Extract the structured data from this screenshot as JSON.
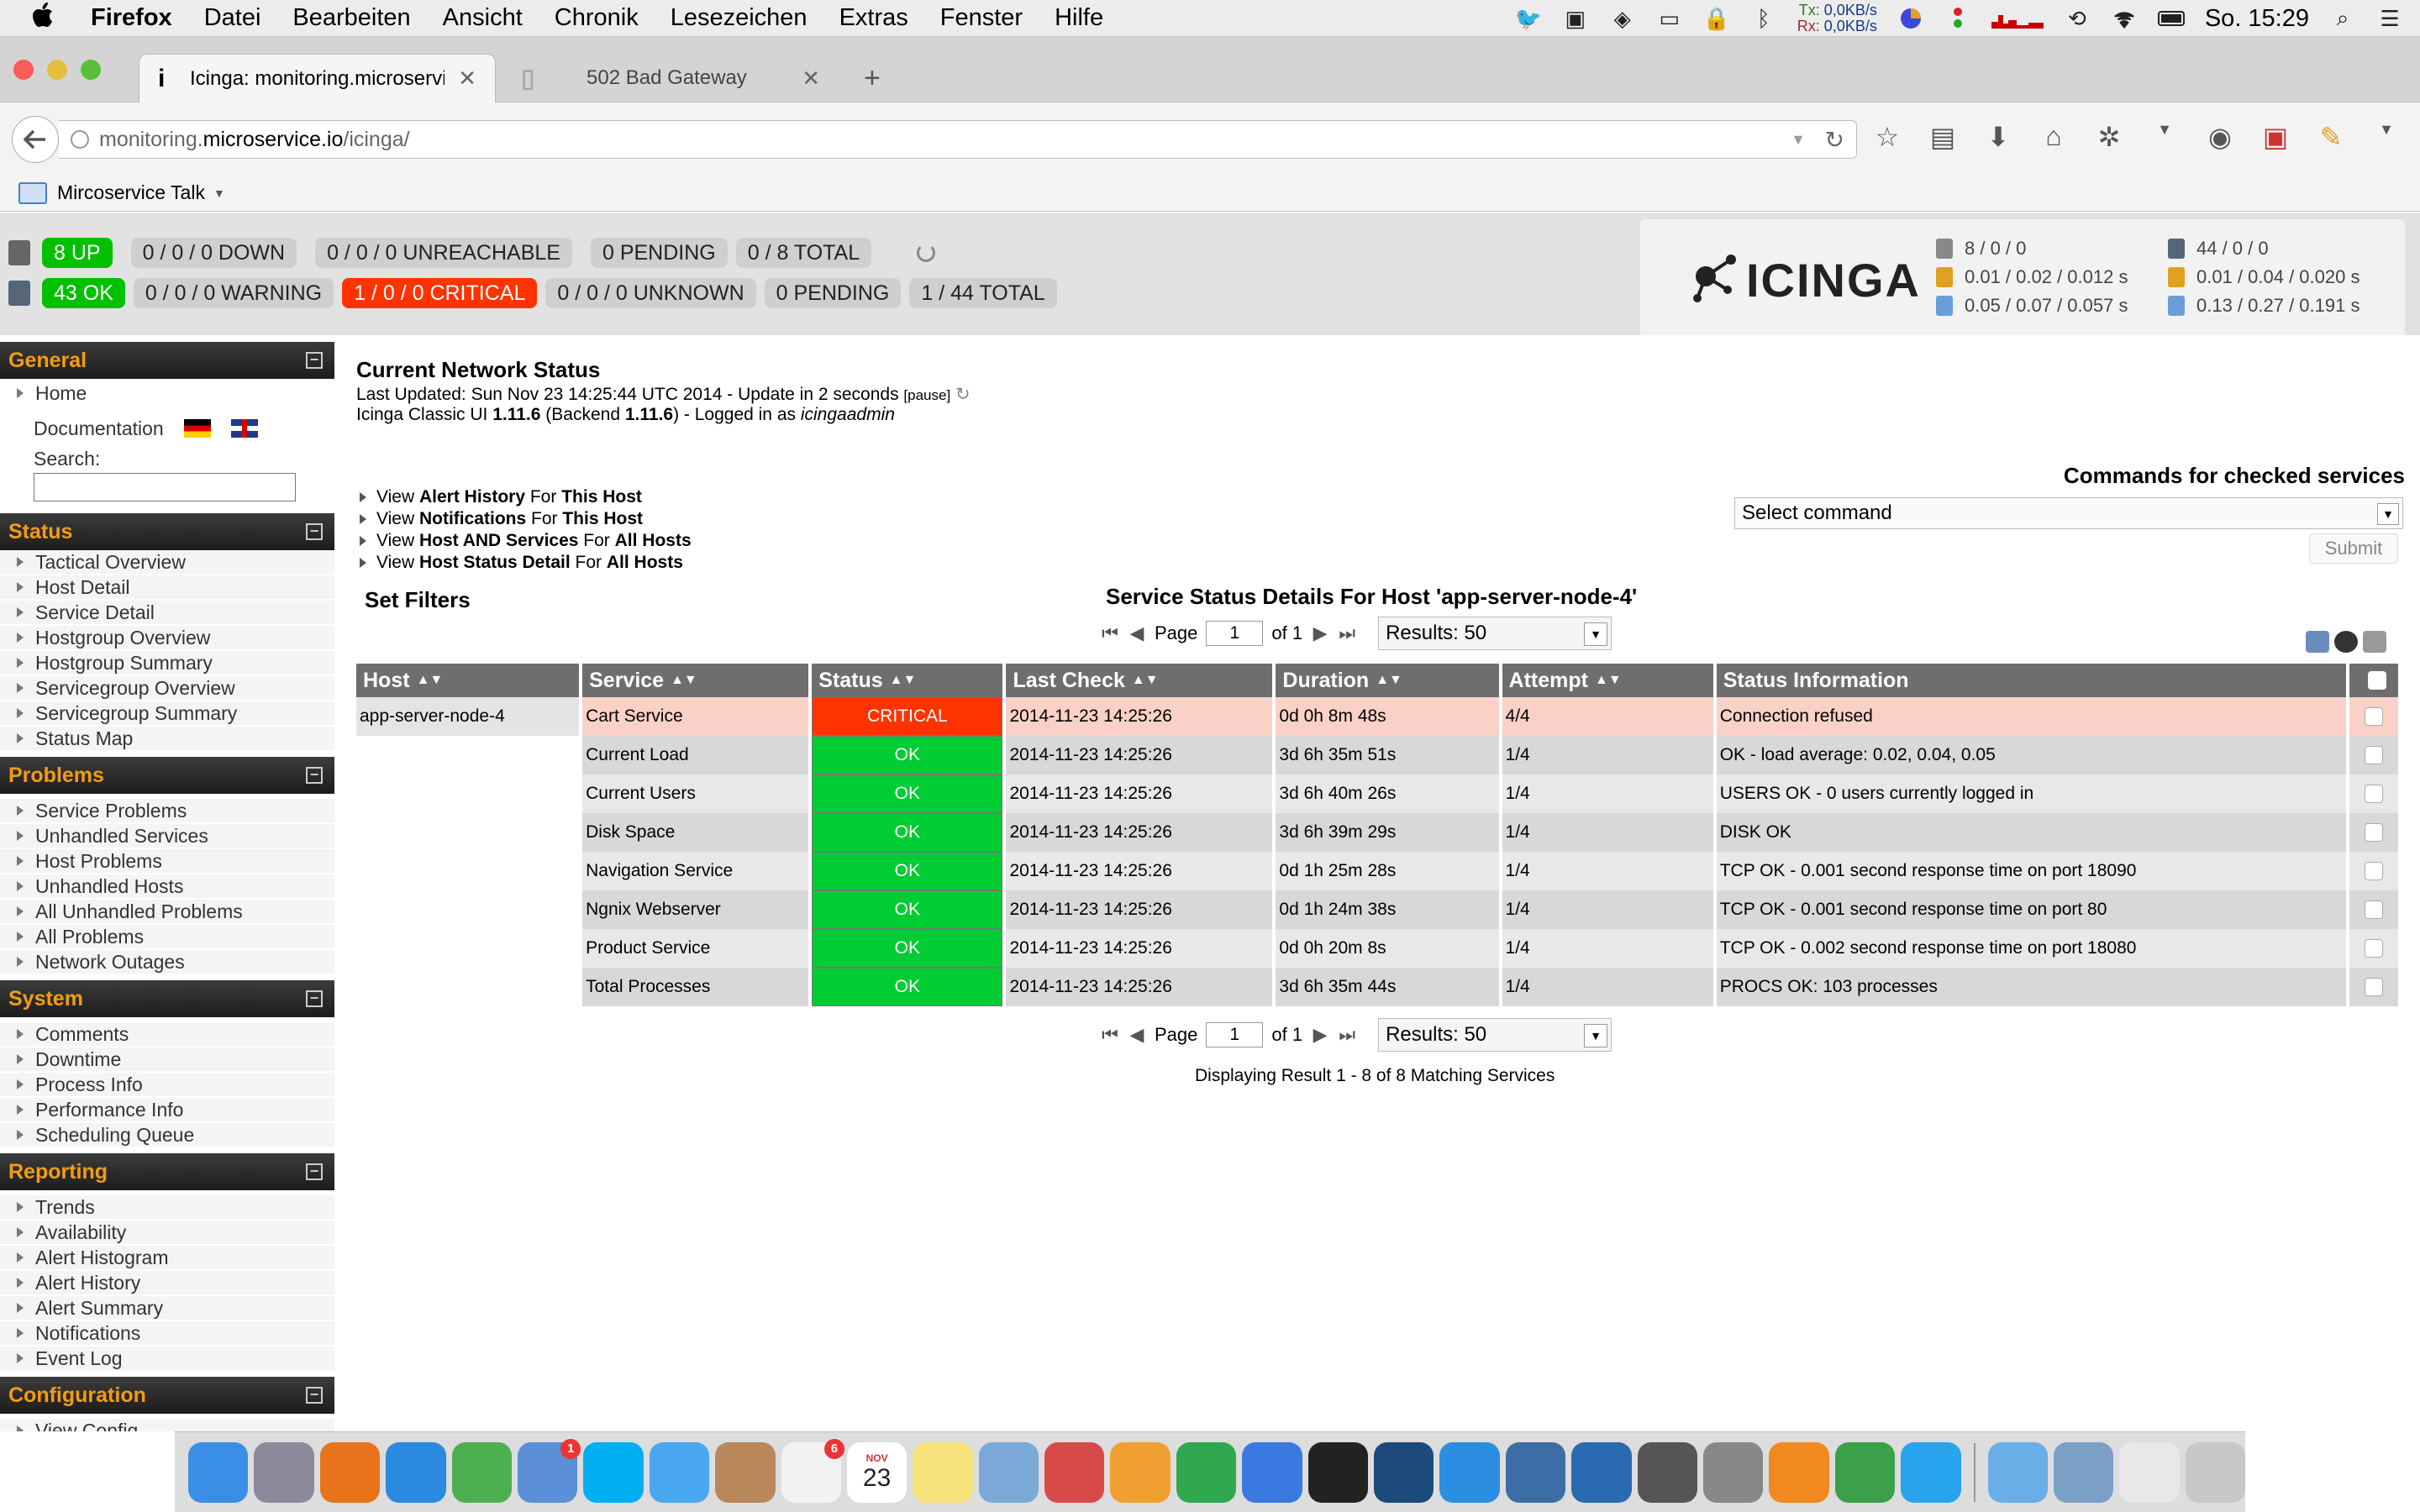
{
  "menubar": {
    "app_name": "Firefox",
    "items": [
      "Datei",
      "Bearbeiten",
      "Ansicht",
      "Chronik",
      "Lesezeichen",
      "Extras",
      "Fenster",
      "Hilfe"
    ],
    "net_tx": "Tx:",
    "net_tx_val": "0,0KB/s",
    "net_rx": "Rx:",
    "net_rx_val": "0,0KB/s",
    "clock": "So. 15:29"
  },
  "browser": {
    "tabs": [
      {
        "icon": "i",
        "title": "Icinga: monitoring.microservi..."
      },
      {
        "icon": "",
        "title": "502 Bad Gateway"
      }
    ],
    "url_prefix": "monitoring.",
    "url_domain": "microservice.io",
    "url_path": "/icinga/",
    "bookmark": "Mircoservice Talk"
  },
  "status_bar": {
    "hosts": {
      "up": "8 UP",
      "down": "0 / 0 / 0 DOWN",
      "unreachable": "0 / 0 / 0 UNREACHABLE",
      "pending": "0 PENDING",
      "total": "0 / 8 TOTAL"
    },
    "services": {
      "ok": "43 OK",
      "warning": "0 / 0 / 0 WARNING",
      "critical": "1 / 0 / 0 CRITICAL",
      "unknown": "0 / 0 / 0 UNKNOWN",
      "pending": "0 PENDING",
      "total": "1 / 44 TOTAL"
    }
  },
  "logo": {
    "word": "ICINGA"
  },
  "perf": {
    "hosts": [
      "8 / 0 / 0",
      "0.01 / 0.02 / 0.012 s",
      "0.05 / 0.07 / 0.057 s"
    ],
    "services": [
      "44 / 0 / 0",
      "0.01 / 0.04 / 0.020 s",
      "0.13 / 0.27 / 0.191 s"
    ]
  },
  "sidebar": {
    "general": {
      "title": "General",
      "home": "Home",
      "documentation": "Documentation",
      "search_label": "Search:"
    },
    "status": {
      "title": "Status",
      "items": [
        "Tactical Overview",
        "Host Detail",
        "Service Detail",
        "Hostgroup Overview",
        "Hostgroup Summary",
        "Servicegroup Overview",
        "Servicegroup Summary",
        "Status Map"
      ]
    },
    "problems": {
      "title": "Problems",
      "items": [
        "Service Problems",
        "Unhandled Services",
        "Host Problems",
        "Unhandled Hosts",
        "All Unhandled Problems",
        "All Problems",
        "Network Outages"
      ]
    },
    "system": {
      "title": "System",
      "items": [
        "Comments",
        "Downtime",
        "Process Info",
        "Performance Info",
        "Scheduling Queue"
      ]
    },
    "reporting": {
      "title": "Reporting",
      "items": [
        "Trends",
        "Availability",
        "Alert Histogram",
        "Alert History",
        "Alert Summary",
        "Notifications",
        "Event Log"
      ]
    },
    "configuration": {
      "title": "Configuration",
      "items": [
        "View Config"
      ]
    }
  },
  "main": {
    "title": "Current Network Status",
    "last_updated": "Last Updated: Sun Nov 23 14:25:44 UTC 2014 - Update in 2 seconds",
    "pause": "[pause]",
    "version_pre": "Icinga Classic UI ",
    "version": "1.11.6",
    "backend_pre": " (Backend ",
    "backend": "1.11.6",
    "logged_in": ") - Logged in as ",
    "user": "icingaadmin",
    "view_links": [
      {
        "pre": "View ",
        "bold": "Alert History",
        "mid": " For ",
        "bold2": "This Host"
      },
      {
        "pre": "View ",
        "bold": "Notifications",
        "mid": " For ",
        "bold2": "This Host"
      },
      {
        "pre": "View ",
        "bold": "Host AND Services",
        "mid": " For ",
        "bold2": "All Hosts"
      },
      {
        "pre": "View ",
        "bold": "Host Status Detail",
        "mid": " For ",
        "bold2": "All Hosts"
      }
    ],
    "set_filters": "Set Filters",
    "commands_title": "Commands for checked services",
    "command_select": "Select command",
    "submit": "Submit",
    "table_title": "Service Status Details For Host 'app-server-node-4'",
    "pager": {
      "page_label": "Page",
      "page_value": "1",
      "of_label": "of 1",
      "results": "Results: 50"
    },
    "columns": [
      "Host",
      "Service",
      "Status",
      "Last Check",
      "Duration",
      "Attempt",
      "Status Information"
    ],
    "rows": [
      {
        "host": "app-server-node-4",
        "service": "Cart Service",
        "status": "CRITICAL",
        "last_check": "2014-11-23 14:25:26",
        "duration": "0d 0h 8m 48s",
        "attempt": "4/4",
        "info": "Connection refused"
      },
      {
        "host": "",
        "service": "Current Load",
        "status": "OK",
        "last_check": "2014-11-23 14:25:26",
        "duration": "3d 6h 35m 51s",
        "attempt": "1/4",
        "info": "OK - load average: 0.02, 0.04, 0.05"
      },
      {
        "host": "",
        "service": "Current Users",
        "status": "OK",
        "last_check": "2014-11-23 14:25:26",
        "duration": "3d 6h 40m 26s",
        "attempt": "1/4",
        "info": "USERS OK - 0 users currently logged in"
      },
      {
        "host": "",
        "service": "Disk Space",
        "status": "OK",
        "last_check": "2014-11-23 14:25:26",
        "duration": "3d 6h 39m 29s",
        "attempt": "1/4",
        "info": "DISK OK"
      },
      {
        "host": "",
        "service": "Navigation Service",
        "status": "OK",
        "last_check": "2014-11-23 14:25:26",
        "duration": "0d 1h 25m 28s",
        "attempt": "1/4",
        "info": "TCP OK - 0.001 second response time on port 18090"
      },
      {
        "host": "",
        "service": "Ngnix Webserver",
        "status": "OK",
        "last_check": "2014-11-23 14:25:26",
        "duration": "0d 1h 24m 38s",
        "attempt": "1/4",
        "info": "TCP OK - 0.001 second response time on port 80"
      },
      {
        "host": "",
        "service": "Product Service",
        "status": "OK",
        "last_check": "2014-11-23 14:25:26",
        "duration": "0d 0h 20m 8s",
        "attempt": "1/4",
        "info": "TCP OK - 0.002 second response time on port 18080"
      },
      {
        "host": "",
        "service": "Total Processes",
        "status": "OK",
        "last_check": "2014-11-23 14:25:26",
        "duration": "3d 6h 35m 44s",
        "attempt": "1/4",
        "info": "PROCS OK: 103 processes"
      }
    ],
    "display_result": "Displaying Result 1 - 8 of 8 Matching Services"
  },
  "dock": {
    "mail_badge": "1",
    "reminders_badge": "6",
    "calendar_month": "NOV",
    "calendar_day": "23",
    "apps": [
      {
        "name": "finder",
        "color": "#3a8ee6"
      },
      {
        "name": "launchpad",
        "color": "#8a8a9a"
      },
      {
        "name": "firefox",
        "color": "#e8731a"
      },
      {
        "name": "safari",
        "color": "#2a8ae0"
      },
      {
        "name": "chrome",
        "color": "#4caf50"
      },
      {
        "name": "mail",
        "color": "#5b8fd8"
      },
      {
        "name": "skype",
        "color": "#00aff0"
      },
      {
        "name": "messages",
        "color": "#4aa8f0"
      },
      {
        "name": "contacts",
        "color": "#b8875a"
      },
      {
        "name": "reminders",
        "color": "#f2f2f2"
      },
      {
        "name": "calendar",
        "color": "#ffffff"
      },
      {
        "name": "notes",
        "color": "#f6e27a"
      },
      {
        "name": "preview",
        "color": "#7aa9d8"
      },
      {
        "name": "photos",
        "color": "#d84a4a"
      },
      {
        "name": "pages",
        "color": "#f0a030"
      },
      {
        "name": "numbers",
        "color": "#2fa84f"
      },
      {
        "name": "keynote",
        "color": "#3a7ae0"
      },
      {
        "name": "terminal",
        "color": "#222222"
      },
      {
        "name": "sourcetree",
        "color": "#1c4a7a"
      },
      {
        "name": "intellij",
        "color": "#2c8ee0"
      },
      {
        "name": "postgres",
        "color": "#3c6ea5"
      },
      {
        "name": "elephant",
        "color": "#2a6ab0"
      },
      {
        "name": "sublime",
        "color": "#555555"
      },
      {
        "name": "system-preferences",
        "color": "#888888"
      },
      {
        "name": "ibooks",
        "color": "#f08a20"
      },
      {
        "name": "gitx",
        "color": "#3ca04a"
      },
      {
        "name": "twitter",
        "color": "#2aa3ef"
      },
      {
        "name": "applications-folder",
        "color": "#6aaee8"
      },
      {
        "name": "home-folder",
        "color": "#7aa0c8"
      },
      {
        "name": "zip-file",
        "color": "#e8e8e8"
      },
      {
        "name": "trash",
        "color": "#c8c8c8"
      }
    ]
  }
}
